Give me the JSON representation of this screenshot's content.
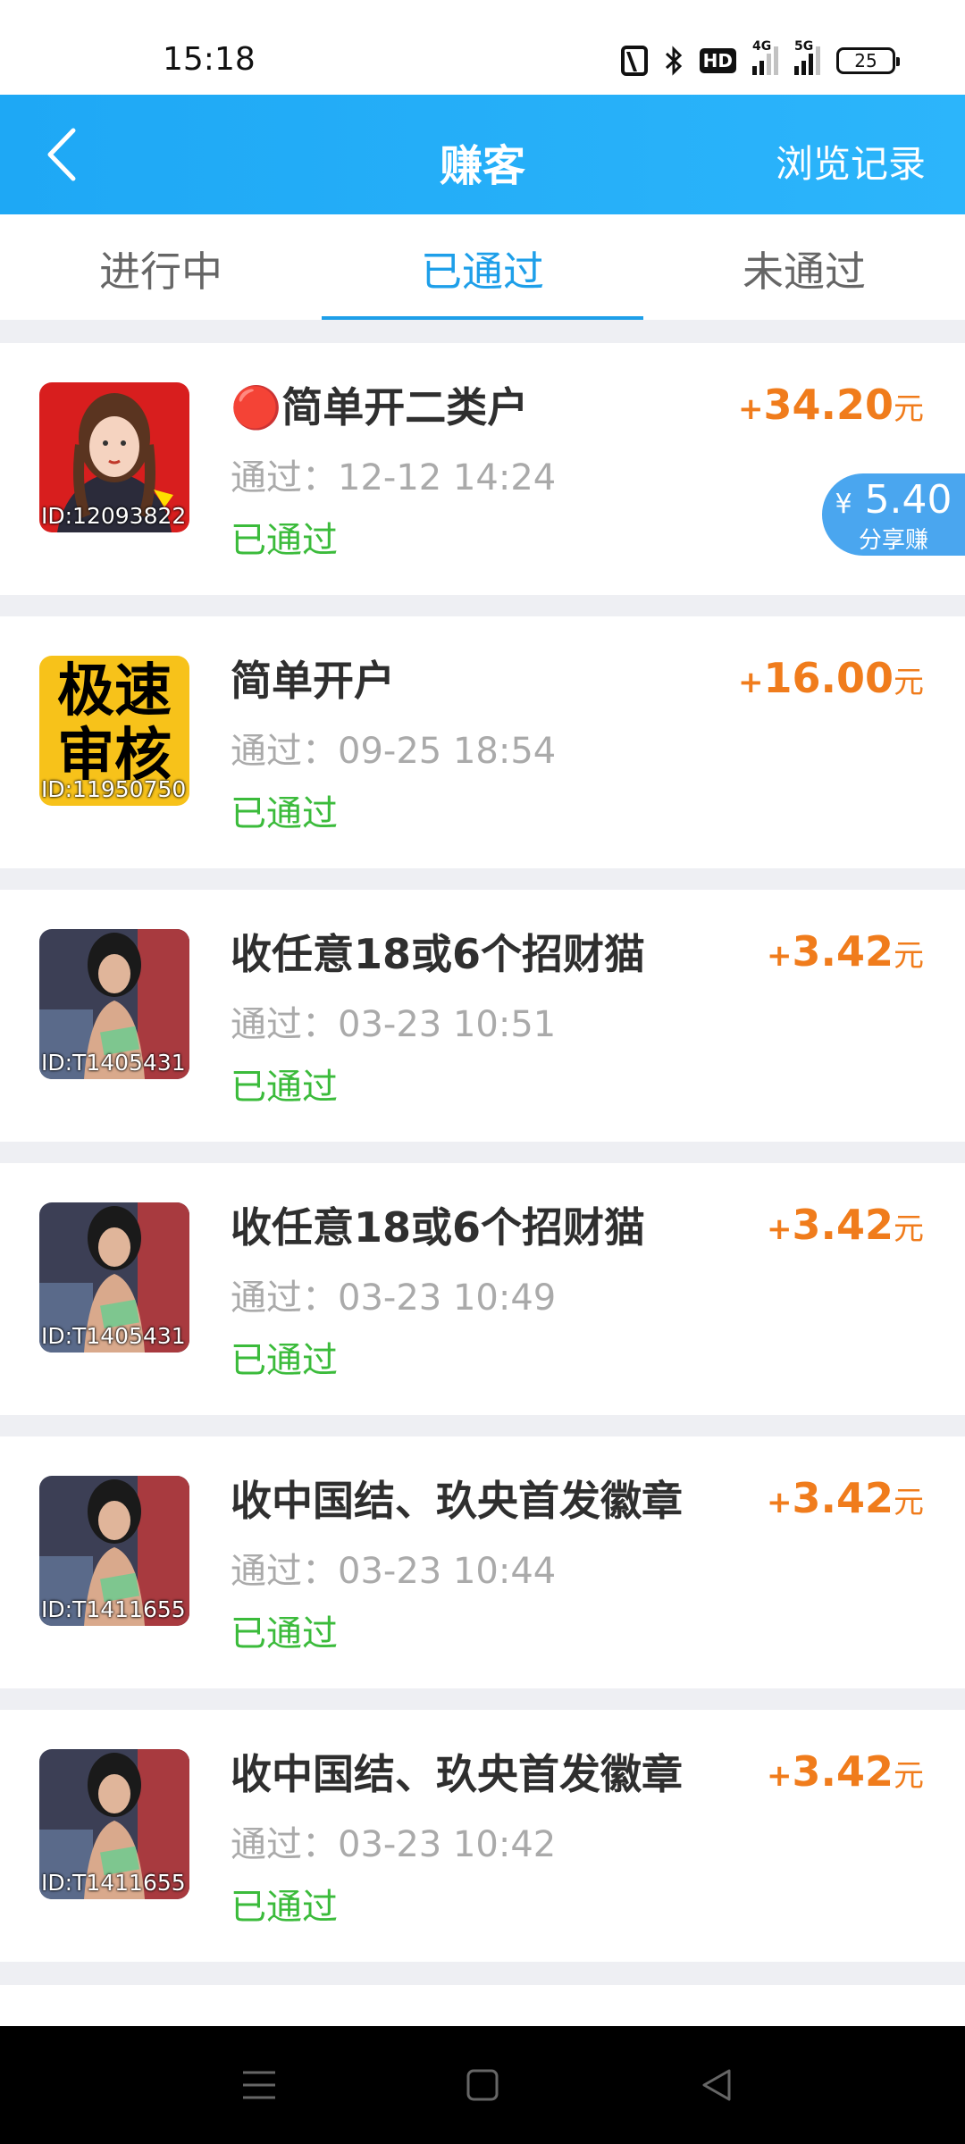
{
  "status_bar": {
    "time": "15:18",
    "hd_label": "HD",
    "net_4g": "4G",
    "net_5g": "5G",
    "battery": "25"
  },
  "header": {
    "title": "赚客",
    "history": "浏览记录"
  },
  "tabs": [
    {
      "label": "进行中",
      "active": false
    },
    {
      "label": "已通过",
      "active": true
    },
    {
      "label": "未通过",
      "active": false
    }
  ],
  "cards": [
    {
      "id_label": "ID:12093822",
      "title": "🔴简单开二类户",
      "time": "通过：12-12 14:24",
      "status": "已通过",
      "plus": "+",
      "amount": "34.20",
      "unit": "元",
      "thumb": "portrait-girl"
    },
    {
      "id_label": "ID:11950750",
      "title": "简单开户",
      "time": "通过：09-25 18:54",
      "status": "已通过",
      "plus": "+",
      "amount": "16.00",
      "unit": "元",
      "thumb": "text-jisu-shenhe"
    },
    {
      "id_label": "ID:T1405431",
      "title": "收任意18或6个招财猫",
      "time": "通过：03-23 10:51",
      "status": "已通过",
      "plus": "+",
      "amount": "3.42",
      "unit": "元",
      "thumb": "photo-person"
    },
    {
      "id_label": "ID:T1405431",
      "title": "收任意18或6个招财猫",
      "time": "通过：03-23 10:49",
      "status": "已通过",
      "plus": "+",
      "amount": "3.42",
      "unit": "元",
      "thumb": "photo-person"
    },
    {
      "id_label": "ID:T1411655",
      "title": "收中国结、玖央首发徽章",
      "time": "通过：03-23 10:44",
      "status": "已通过",
      "plus": "+",
      "amount": "3.42",
      "unit": "元",
      "thumb": "photo-person"
    },
    {
      "id_label": "ID:T1411655",
      "title": "收中国结、玖央首发徽章",
      "time": "通过：03-23 10:42",
      "status": "已通过",
      "plus": "+",
      "amount": "3.42",
      "unit": "元",
      "thumb": "photo-person"
    }
  ],
  "share_badge": {
    "currency": "¥",
    "amount": "5.40",
    "label": "分享赚"
  },
  "thumb_text": {
    "line1": "极速",
    "line2": "审核"
  },
  "colors": {
    "header_blue": "#1ea8f5",
    "reward_orange": "#f07c1c",
    "status_green": "#3bbb3b",
    "tab_active": "#1e9fe9"
  }
}
